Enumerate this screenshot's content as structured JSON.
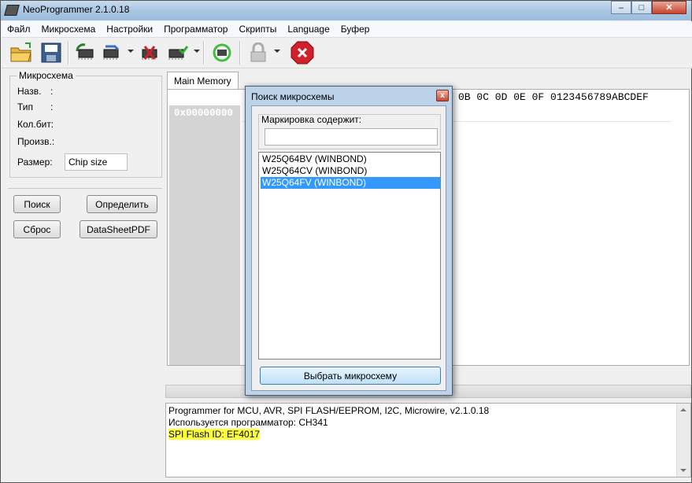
{
  "window": {
    "title": "NeoProgrammer 2.1.0.18"
  },
  "menu": [
    "Файл",
    "Микросхема",
    "Настройки",
    "Программатор",
    "Скрипты",
    "Language",
    "Буфер"
  ],
  "toolbar": {
    "icons": [
      "open-folder-icon",
      "save-floppy-icon",
      "read-chip-icon",
      "write-chip-icon",
      "erase-chip-icon",
      "verify-chip-icon",
      "auto-chip-icon",
      "lock-icon",
      "stop-icon"
    ],
    "colors": {
      "stop": "#d0202a",
      "chip": "#2f7d2a"
    }
  },
  "chip_panel": {
    "legend": "Микросхема",
    "name_label": "Назв.",
    "type_label": "Тип",
    "bits_label": "Кол.бит:",
    "vendor_label": "Произв.:",
    "size_label": "Размер:",
    "size_value": "Chip size",
    "colon": ":"
  },
  "buttons": {
    "search": "Поиск",
    "detect": "Определить",
    "reset": "Сброс",
    "datasheet": "DataSheetPDF"
  },
  "tabs": {
    "main_memory": "Main Memory"
  },
  "hex": {
    "header_tail": "0B 0C 0D 0E 0F  0123456789ABCDEF",
    "address": "0x00000000"
  },
  "log": {
    "lines": [
      "Programmer for MCU, AVR, SPI FLASH/EEPROM, I2C, Microwire,  v2.1.0.18",
      "Используется программатор: CH341",
      "SPI Flash ID: EF4017"
    ],
    "highlight_color": "#ffff3c"
  },
  "dialog": {
    "title": "Поиск микросхемы",
    "filter_label": "Маркировка содержит:",
    "filter_value": "",
    "items": [
      "W25Q64BV (WINBOND)",
      "W25Q64CV (WINBOND)",
      "W25Q64FV (WINBOND)"
    ],
    "selected_index": 2,
    "select_button": "Выбрать микросхему"
  }
}
